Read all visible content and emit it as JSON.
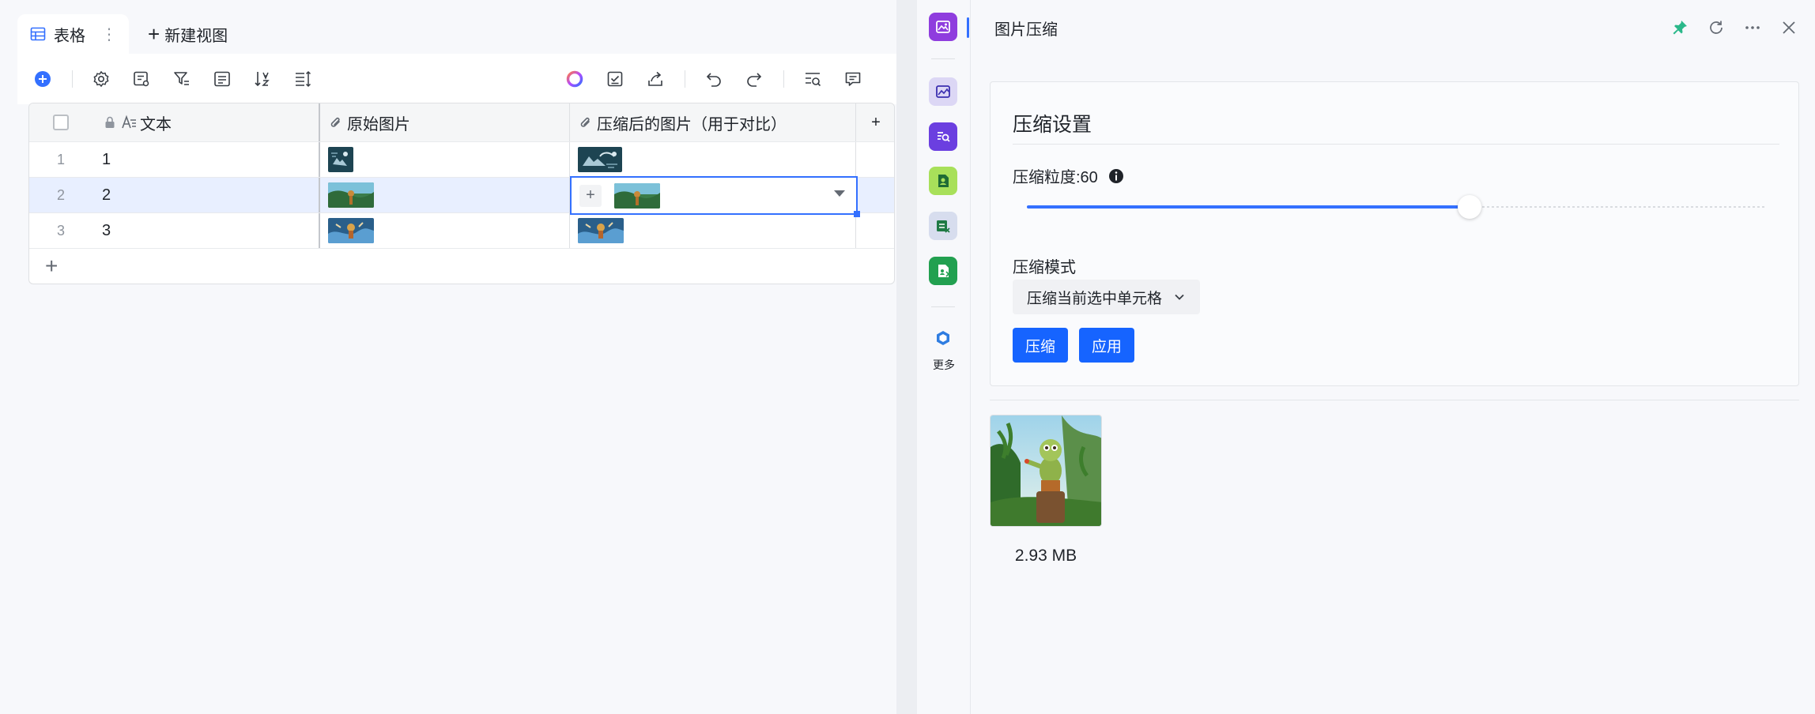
{
  "viewbar": {
    "tab_label": "表格",
    "tab_more": "⋮",
    "new_view_plus": "+",
    "new_view_label": "新建视图"
  },
  "toolbar": {
    "left_icons": [
      "add-circle-icon",
      "settings-icon",
      "field-manager-icon",
      "filter-icon",
      "group-icon",
      "sort-icon",
      "row-height-icon"
    ],
    "right_icons": [
      "ai-ring-icon",
      "checklist-icon",
      "share-icon",
      "undo-icon",
      "redo-icon",
      "search-icon",
      "comment-icon"
    ]
  },
  "grid": {
    "columns": [
      "文本",
      "原始图片",
      "压缩后的图片（用于对比）"
    ],
    "add_column": "+",
    "rows": [
      {
        "index": "1",
        "text": "1"
      },
      {
        "index": "2",
        "text": "2"
      },
      {
        "index": "3",
        "text": "3"
      }
    ],
    "selected_add": "+",
    "add_row": "+"
  },
  "rail": {
    "icons": [
      "image-compress-icon",
      "image-edit-icon",
      "text-recognize-icon",
      "image-person-icon",
      "sheet-export-icon",
      "image-share-icon",
      "more-cube-icon"
    ],
    "more_label": "更多"
  },
  "panel": {
    "title": "图片压缩",
    "actions": [
      "pin-icon",
      "refresh-icon",
      "more-icon",
      "close-icon"
    ],
    "more_glyph": "···",
    "card_title": "压缩设置",
    "granularity_label": "压缩粒度:60",
    "granularity_value": 60,
    "mode_label": "压缩模式",
    "mode_selected": "压缩当前选中单元格",
    "btn_compress": "压缩",
    "btn_apply": "应用",
    "preview_size": "2.93 MB"
  },
  "colors": {
    "accent": "#1664ff",
    "pin": "#2bb88a"
  }
}
